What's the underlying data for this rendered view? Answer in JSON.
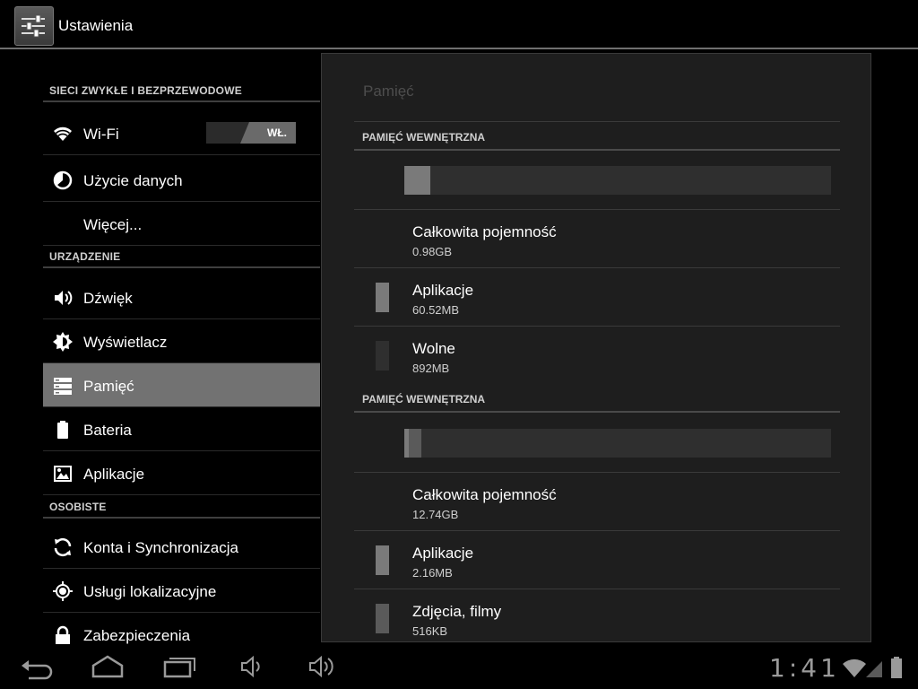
{
  "actionbar": {
    "title": "Ustawienia",
    "icon": "settings-sliders-icon"
  },
  "sections": {
    "wireless": "SIECI ZWYKŁE I BEZPRZEWODOWE",
    "device": "URZĄDZENIE",
    "personal": "OSOBISTE"
  },
  "menu": {
    "wifi": {
      "label": "Wi-Fi",
      "toggle": "WŁ.",
      "icon": "wifi-icon"
    },
    "data_usage": {
      "label": "Użycie danych",
      "icon": "data-usage-icon"
    },
    "more": {
      "label": "Więcej..."
    },
    "sound": {
      "label": "Dźwięk",
      "icon": "speaker-icon"
    },
    "display": {
      "label": "Wyświetlacz",
      "icon": "brightness-icon"
    },
    "storage": {
      "label": "Pamięć",
      "icon": "storage-icon",
      "selected": true
    },
    "battery": {
      "label": "Bateria",
      "icon": "battery-icon"
    },
    "apps": {
      "label": "Aplikacje",
      "icon": "apps-icon"
    },
    "accounts": {
      "label": "Konta i Synchronizacja",
      "icon": "sync-icon"
    },
    "location": {
      "label": "Usługi lokalizacyjne",
      "icon": "location-icon"
    },
    "security": {
      "label": "Zabezpieczenia",
      "icon": "lock-icon"
    }
  },
  "panel": {
    "title": "Pamięć",
    "internal1": {
      "header": "PAMIĘĆ WEWNĘTRZNA",
      "usage_fraction": 0.06,
      "total": {
        "title": "Całkowita pojemność",
        "value": "0.98GB"
      },
      "apps": {
        "title": "Aplikacje",
        "value": "60.52MB"
      },
      "free": {
        "title": "Wolne",
        "value": "892MB"
      }
    },
    "internal2": {
      "header": "PAMIĘĆ WEWNĘTRZNA",
      "total": {
        "title": "Całkowita pojemność",
        "value": "12.74GB"
      },
      "apps": {
        "title": "Aplikacje",
        "value": "2.16MB"
      },
      "media": {
        "title": "Zdjęcia, filmy",
        "value": "516KB"
      }
    }
  },
  "colors": {
    "selected": "#727272",
    "apps_segment": "#7a7a7a",
    "free_segment": "#2f2f2f",
    "media_segment": "#5a5a5a"
  },
  "statusbar": {
    "time": "1:41"
  }
}
